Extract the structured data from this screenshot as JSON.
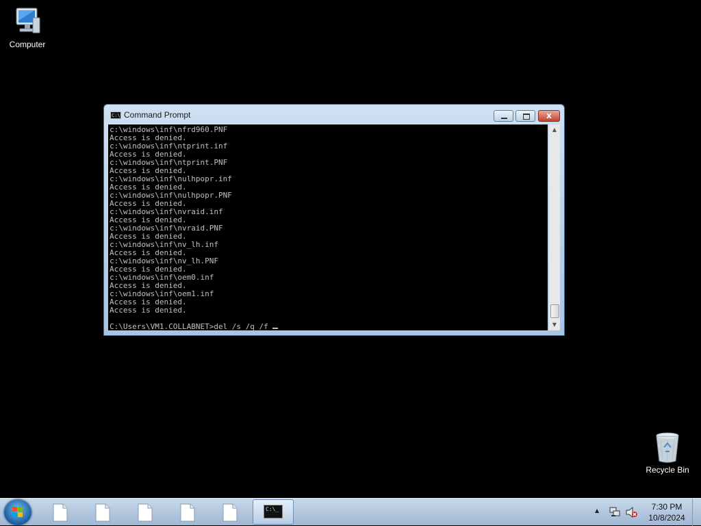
{
  "desktop": {
    "icons": [
      {
        "label": "Computer"
      },
      {
        "label": "Recycle Bin"
      }
    ]
  },
  "window": {
    "title": "Command Prompt",
    "close_glyph": "x",
    "console_lines": [
      "c:\\windows\\inf\\nfrd960.PNF",
      "Access is denied.",
      "c:\\windows\\inf\\ntprint.inf",
      "Access is denied.",
      "c:\\windows\\inf\\ntprint.PNF",
      "Access is denied.",
      "c:\\windows\\inf\\nulhpopr.inf",
      "Access is denied.",
      "c:\\windows\\inf\\nulhpopr.PNF",
      "Access is denied.",
      "c:\\windows\\inf\\nvraid.inf",
      "Access is denied.",
      "c:\\windows\\inf\\nvraid.PNF",
      "Access is denied.",
      "c:\\windows\\inf\\nv_lh.inf",
      "Access is denied.",
      "c:\\windows\\inf\\nv_lh.PNF",
      "Access is denied.",
      "c:\\windows\\inf\\oem0.inf",
      "Access is denied.",
      "c:\\windows\\inf\\oem1.inf",
      "Access is denied.",
      "Access is denied.",
      "",
      "C:\\Users\\VM1.COLLABNET>del /s /q /f "
    ],
    "scroll_position": 0.95
  },
  "taskbar": {
    "pinned": [
      "file-icon",
      "file-icon",
      "file-icon",
      "file-icon",
      "file-icon"
    ],
    "active_app": "command-prompt-icon",
    "cmd_glyph": "C:\\_",
    "tray": {
      "show_hidden": "▲",
      "time": "7:30 PM",
      "date": "10/8/2024"
    }
  }
}
